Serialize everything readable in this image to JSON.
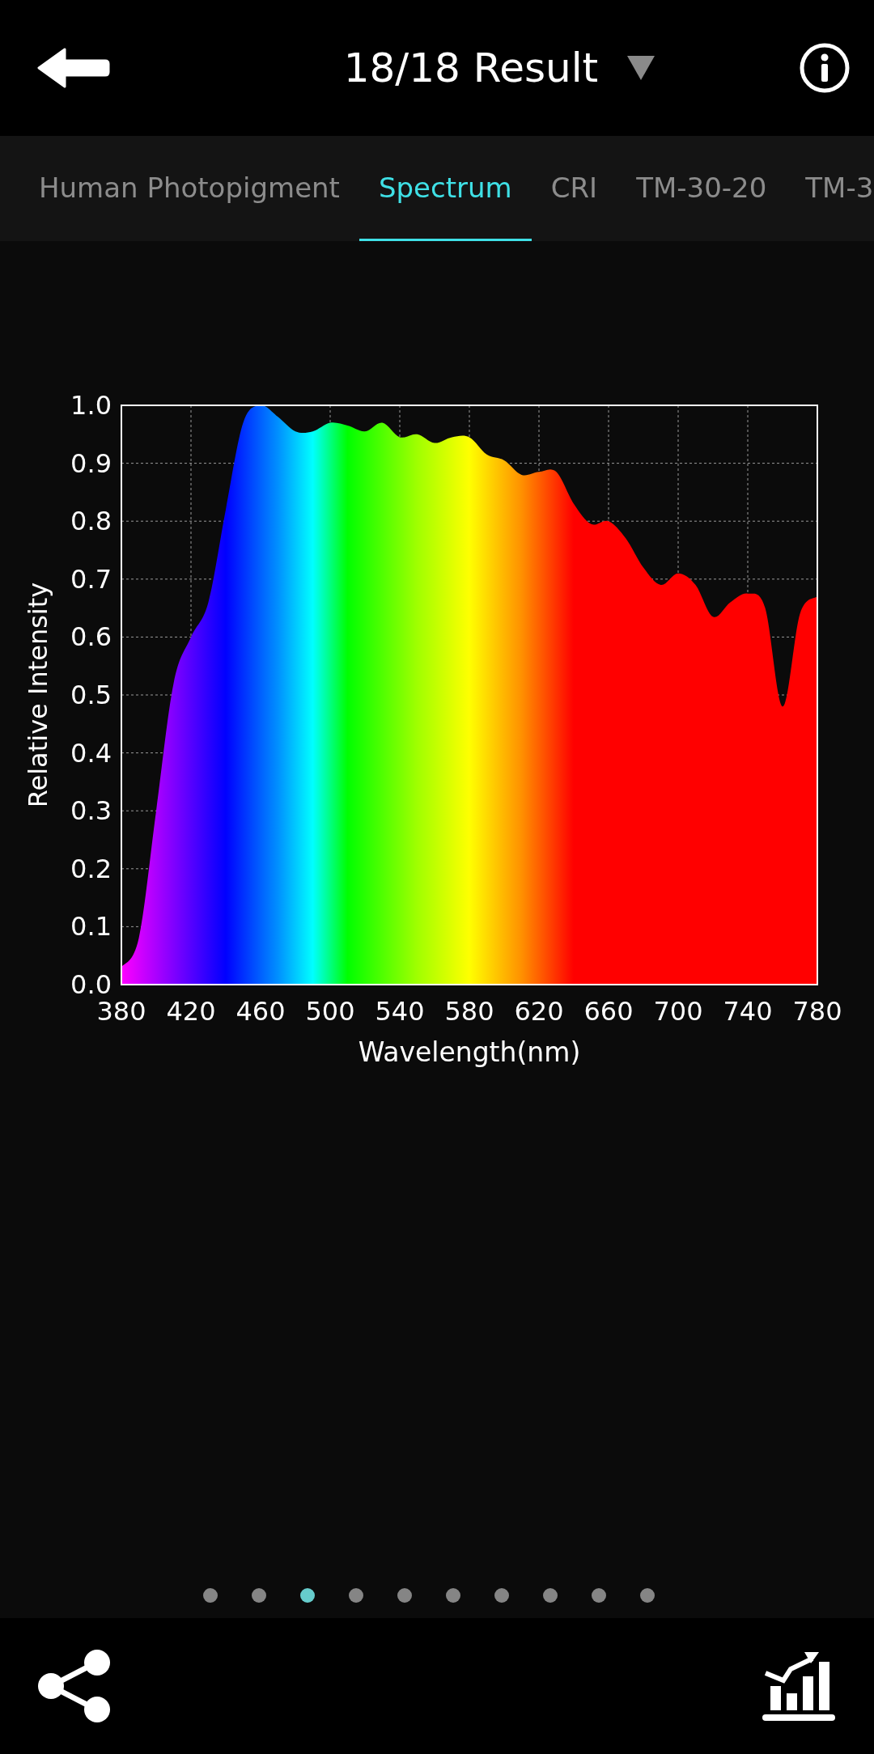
{
  "header": {
    "title": "18/18 Result"
  },
  "tabs": [
    {
      "label": "Human Photopigment",
      "selected": false
    },
    {
      "label": "Spectrum",
      "selected": true
    },
    {
      "label": "CRI",
      "selected": false
    },
    {
      "label": "TM-30-20",
      "selected": false
    },
    {
      "label": "TM-3",
      "selected": false
    }
  ],
  "chart": {
    "chart_data": {
      "type": "area",
      "xlabel": "Wavelength(nm)",
      "ylabel": "Relative Intensity",
      "x": [
        380,
        390,
        400,
        410,
        420,
        430,
        440,
        450,
        460,
        470,
        480,
        490,
        500,
        510,
        520,
        530,
        540,
        550,
        560,
        570,
        580,
        590,
        600,
        610,
        620,
        630,
        640,
        650,
        660,
        670,
        680,
        690,
        700,
        710,
        720,
        730,
        740,
        750,
        760,
        770,
        780
      ],
      "values": [
        0.03,
        0.08,
        0.3,
        0.52,
        0.6,
        0.66,
        0.82,
        0.97,
        1.0,
        0.98,
        0.955,
        0.955,
        0.97,
        0.965,
        0.955,
        0.97,
        0.945,
        0.95,
        0.935,
        0.945,
        0.945,
        0.915,
        0.905,
        0.88,
        0.885,
        0.885,
        0.83,
        0.795,
        0.8,
        0.77,
        0.72,
        0.69,
        0.71,
        0.69,
        0.635,
        0.66,
        0.675,
        0.65,
        0.48,
        0.64,
        0.67
      ],
      "xlim": [
        380,
        780
      ],
      "ylim": [
        0,
        1
      ],
      "grid": true,
      "xticks": [
        380,
        420,
        460,
        500,
        540,
        580,
        620,
        660,
        700,
        740,
        780
      ],
      "yticks": [
        {
          "value": 0,
          "label": "0.0"
        },
        {
          "value": 0.1,
          "label": "0.1"
        },
        {
          "value": 0.2,
          "label": "0.2"
        },
        {
          "value": 0.3,
          "label": "0.3"
        },
        {
          "value": 0.4,
          "label": "0.4"
        },
        {
          "value": 0.5,
          "label": "0.5"
        },
        {
          "value": 0.6,
          "label": "0.6"
        },
        {
          "value": 0.7,
          "label": "0.7"
        },
        {
          "value": 0.8,
          "label": "0.8"
        },
        {
          "value": 0.9,
          "label": "0.9"
        },
        {
          "value": 1.0,
          "label": "1.0"
        }
      ]
    }
  },
  "pagination": [
    {
      "selected": false
    },
    {
      "selected": false
    },
    {
      "selected": true
    },
    {
      "selected": false
    },
    {
      "selected": false
    },
    {
      "selected": false
    },
    {
      "selected": false
    },
    {
      "selected": false
    },
    {
      "selected": false
    },
    {
      "selected": false
    }
  ]
}
